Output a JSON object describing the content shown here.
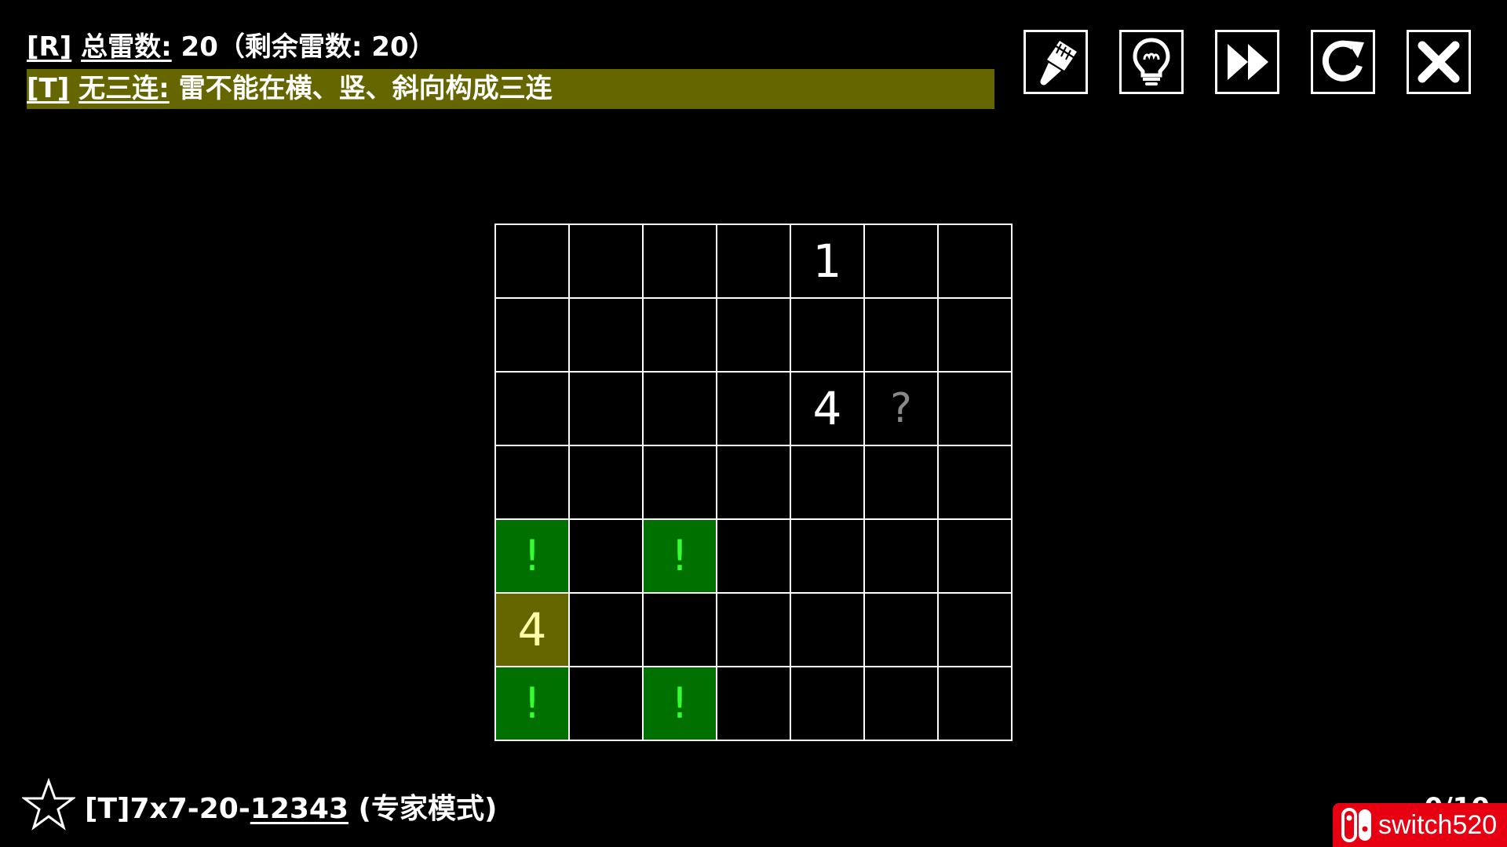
{
  "header": {
    "rule_r": {
      "tag": "[R]",
      "text": "总雷数:",
      "rest": " 20（剩余雷数: 20）"
    },
    "rule_t": {
      "tag": "[T]",
      "text": "无三连:",
      "rest": " 雷不能在横、竖、斜向构成三连"
    },
    "highlight_color": "#666600"
  },
  "toolbar": {
    "buttons": [
      {
        "name": "brush-icon"
      },
      {
        "name": "lightbulb-icon"
      },
      {
        "name": "fast-forward-icon"
      },
      {
        "name": "restart-icon"
      },
      {
        "name": "close-icon"
      }
    ]
  },
  "board": {
    "rows": 7,
    "cols": 7,
    "cells": [
      [
        "",
        "",
        "",
        "",
        "1",
        "",
        ""
      ],
      [
        "",
        "",
        "",
        "",
        "",
        "",
        ""
      ],
      [
        "",
        "",
        "",
        "",
        "4",
        "?",
        ""
      ],
      [
        "",
        "",
        "",
        "",
        "",
        "",
        ""
      ],
      [
        "!",
        "",
        "!",
        "",
        "",
        "",
        ""
      ],
      [
        "4",
        "",
        "",
        "",
        "",
        "",
        ""
      ],
      [
        "!",
        "",
        "!",
        "",
        "",
        "",
        ""
      ]
    ],
    "highlighted_cells": [
      [
        5,
        0
      ]
    ],
    "colors": {
      "mine_hint_bg": "#007000",
      "mine_hint_fg": "#33ff33",
      "highlight_bg": "#666600",
      "highlight_fg": "#ffffaa",
      "question_fg": "#888888"
    }
  },
  "footer": {
    "star_icon": "star-outline-icon",
    "level_prefix": "[T]7x7-20-",
    "level_id": "12343",
    "level_mode": " (专家模式)",
    "progress": "0/10"
  },
  "watermark": {
    "icon": "nintendo-switch-logo-icon",
    "text": "switch520",
    "color": "#e60012"
  }
}
